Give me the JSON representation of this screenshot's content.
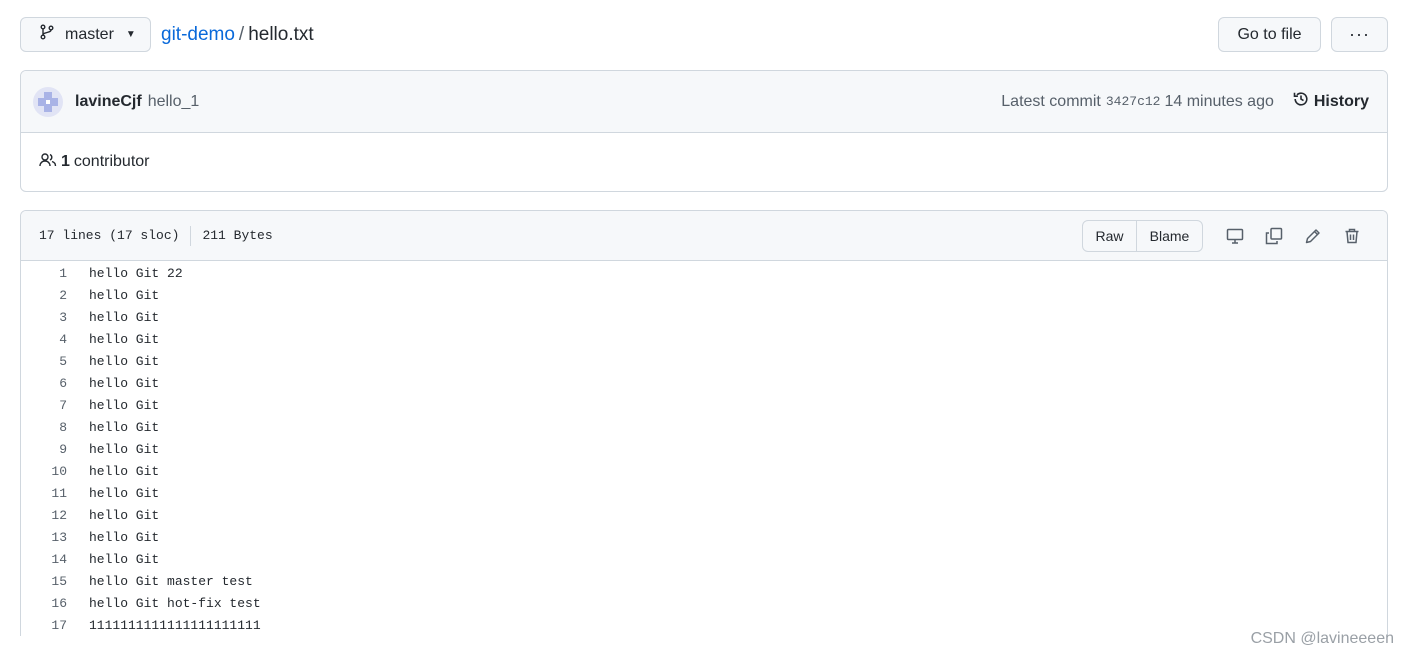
{
  "header": {
    "branch": "master",
    "repo": "git-demo",
    "separator": "/",
    "file": "hello.txt",
    "goto_file": "Go to file",
    "more": "···"
  },
  "commit": {
    "author": "lavineCjf",
    "message": "hello_1",
    "latest_label": "Latest commit",
    "sha": "3427c12",
    "time": "14 minutes ago",
    "history": "History"
  },
  "contributors": {
    "count": "1",
    "label": "contributor"
  },
  "file": {
    "lines_info": "17 lines (17 sloc)",
    "size": "211 Bytes",
    "raw": "Raw",
    "blame": "Blame"
  },
  "code_lines": [
    {
      "n": "1",
      "t": "hello Git 22"
    },
    {
      "n": "2",
      "t": "hello Git"
    },
    {
      "n": "3",
      "t": "hello Git"
    },
    {
      "n": "4",
      "t": "hello Git"
    },
    {
      "n": "5",
      "t": "hello Git"
    },
    {
      "n": "6",
      "t": "hello Git"
    },
    {
      "n": "7",
      "t": "hello Git"
    },
    {
      "n": "8",
      "t": "hello Git"
    },
    {
      "n": "9",
      "t": "hello Git"
    },
    {
      "n": "10",
      "t": "hello Git"
    },
    {
      "n": "11",
      "t": "hello Git"
    },
    {
      "n": "12",
      "t": "hello Git"
    },
    {
      "n": "13",
      "t": "hello Git"
    },
    {
      "n": "14",
      "t": "hello Git"
    },
    {
      "n": "15",
      "t": "hello Git master test"
    },
    {
      "n": "16",
      "t": "hello Git hot-fix test"
    },
    {
      "n": "17",
      "t": "1111111111111111111111"
    }
  ],
  "watermark": "CSDN @lavineeeen",
  "colors": {
    "link": "#0969da",
    "muted": "#57606a",
    "border": "#d0d7de",
    "header_bg": "#f6f8fa"
  }
}
